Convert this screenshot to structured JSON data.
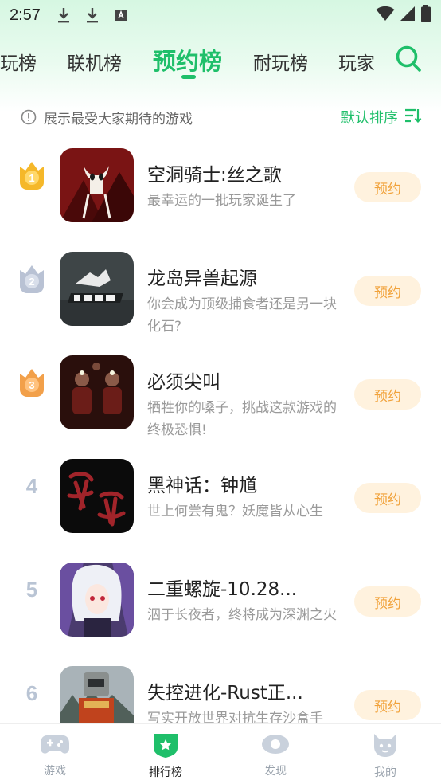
{
  "status_bar": {
    "time": "2:57",
    "icons": [
      "download-icon",
      "download-icon",
      "app-a-icon"
    ],
    "right_icons": [
      "wifi-icon",
      "signal-icon",
      "battery-icon"
    ]
  },
  "tabs": [
    {
      "label": "玩榜"
    },
    {
      "label": "联机榜"
    },
    {
      "label": "预约榜",
      "active": true
    },
    {
      "label": "耐玩榜"
    },
    {
      "label": "玩家"
    }
  ],
  "hint": {
    "text": "展示最受大家期待的游戏",
    "sort_label": "默认排序"
  },
  "reserve_label": "预约",
  "games": [
    {
      "rank": "1",
      "title": "空洞骑士:丝之歌",
      "desc": "最幸运的一批玩家诞生了"
    },
    {
      "rank": "2",
      "title": "龙岛异兽起源",
      "desc": "你会成为顶级捕食者还是另一块化石?"
    },
    {
      "rank": "3",
      "title": "必须尖叫",
      "desc": "牺牲你的嗓子，挑战这款游戏的终极恐惧!"
    },
    {
      "rank": "4",
      "title": "黑神话：钟馗",
      "desc": "世上何尝有鬼？妖魔皆从心生"
    },
    {
      "rank": "5",
      "title": "二重螺旋-10.28...",
      "desc": "泅于长夜者，终将成为深渊之火"
    },
    {
      "rank": "6",
      "title": "失控进化-Rust正...",
      "desc": "写实开放世界对抗生存沙盒手"
    }
  ],
  "bottom_nav": [
    {
      "label": "游戏"
    },
    {
      "label": "排行榜",
      "active": true
    },
    {
      "label": "发现"
    },
    {
      "label": "我的"
    }
  ],
  "colors": {
    "accent": "#1fbf6a",
    "reserve_bg": "#fff2de",
    "reserve_text": "#f1a23a",
    "gold": "#f5b82a",
    "silver": "#b9c2d4",
    "bronze": "#f2a04a"
  }
}
